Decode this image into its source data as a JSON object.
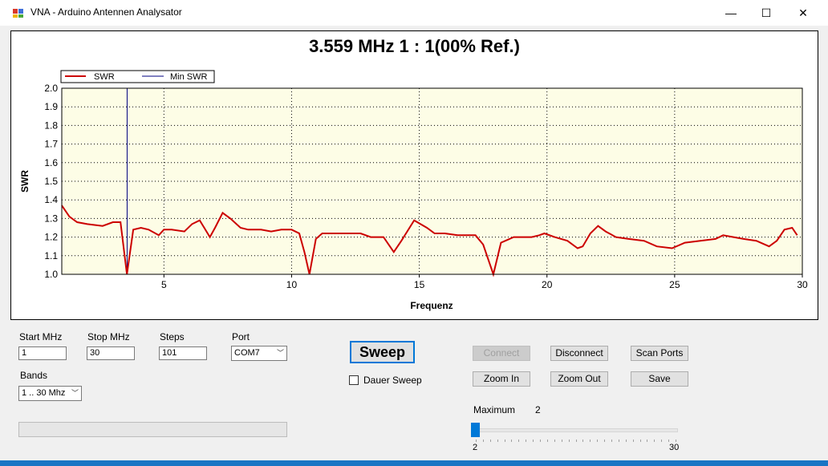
{
  "window": {
    "title": "VNA - Arduino Antennen Analysator",
    "minimize_glyph": "—",
    "maximize_glyph": "☐",
    "close_glyph": "✕"
  },
  "chart_header": "3.559 MHz   1 : 1(00% Ref.)",
  "chart_data": {
    "type": "line",
    "title": "3.559 MHz   1 : 1(00% Ref.)",
    "xlabel": "Frequenz",
    "ylabel": "SWR",
    "xlim": [
      1,
      30
    ],
    "ylim": [
      1.0,
      2.0
    ],
    "x_ticks": [
      "5",
      "10",
      "15",
      "20",
      "25",
      "30"
    ],
    "y_ticks": [
      "1.0",
      "1.1",
      "1.2",
      "1.3",
      "1.4",
      "1.5",
      "1.6",
      "1.7",
      "1.8",
      "1.9",
      "2.0"
    ],
    "grid": true,
    "legend_placement": "top-left",
    "colors": {
      "swr": "#cc0000",
      "min_swr": "#000080",
      "plot_bg": "#fdfde6"
    },
    "series": [
      {
        "name": "SWR",
        "x": [
          1.0,
          1.3,
          1.6,
          2.0,
          2.6,
          3.0,
          3.3,
          3.55,
          3.8,
          4.1,
          4.4,
          4.8,
          5.0,
          5.3,
          5.8,
          6.1,
          6.4,
          6.8,
          7.0,
          7.3,
          7.6,
          8.0,
          8.3,
          8.8,
          9.2,
          9.6,
          10.0,
          10.3,
          10.5,
          10.7,
          10.95,
          11.2,
          11.6,
          12.2,
          12.7,
          13.1,
          13.6,
          14.0,
          14.3,
          14.8,
          15.3,
          15.6,
          16.0,
          16.5,
          17.2,
          17.5,
          17.9,
          18.2,
          18.7,
          19.4,
          19.7,
          19.9,
          20.3,
          20.8,
          21.2,
          21.4,
          21.7,
          22.0,
          22.3,
          22.7,
          23.2,
          23.8,
          24.3,
          24.9,
          25.4,
          26.0,
          26.6,
          26.9,
          27.3,
          27.7,
          28.2,
          28.7,
          29.0,
          29.3,
          29.6,
          29.8
        ],
        "values": [
          1.37,
          1.31,
          1.28,
          1.27,
          1.26,
          1.28,
          1.28,
          1.0,
          1.24,
          1.25,
          1.24,
          1.21,
          1.24,
          1.24,
          1.23,
          1.27,
          1.29,
          1.2,
          1.25,
          1.33,
          1.3,
          1.25,
          1.24,
          1.24,
          1.23,
          1.24,
          1.24,
          1.22,
          1.12,
          1.0,
          1.19,
          1.22,
          1.22,
          1.22,
          1.22,
          1.2,
          1.2,
          1.12,
          1.18,
          1.29,
          1.25,
          1.22,
          1.22,
          1.21,
          1.21,
          1.16,
          1.0,
          1.17,
          1.2,
          1.2,
          1.21,
          1.22,
          1.2,
          1.18,
          1.14,
          1.15,
          1.22,
          1.26,
          1.23,
          1.2,
          1.19,
          1.18,
          1.15,
          1.14,
          1.17,
          1.18,
          1.19,
          1.21,
          1.2,
          1.19,
          1.18,
          1.15,
          1.18,
          1.24,
          1.25,
          1.21
        ]
      },
      {
        "name": "Min SWR",
        "x_marker": 3.559
      }
    ]
  },
  "controls": {
    "start_label": "Start MHz",
    "start_value": "1",
    "stop_label": "Stop MHz",
    "stop_value": "30",
    "steps_label": "Steps",
    "steps_value": "101",
    "port_label": "Port",
    "port_value": "COM7",
    "bands_label": "Bands",
    "bands_value": "1 .. 30 Mhz",
    "sweep_label": "Sweep",
    "dauer_sweep_label": "Dauer Sweep",
    "connect_label": "Connect",
    "disconnect_label": "Disconnect",
    "scan_ports_label": "Scan Ports",
    "zoom_in_label": "Zoom In",
    "zoom_out_label": "Zoom Out",
    "save_label": "Save",
    "maximum_label": "Maximum",
    "maximum_value": "2",
    "slider_min_label": "2",
    "slider_max_label": "30",
    "slider_fraction": 0.0
  },
  "icons": {
    "app": "app-icon",
    "dropdown": "chevron-down-icon"
  }
}
